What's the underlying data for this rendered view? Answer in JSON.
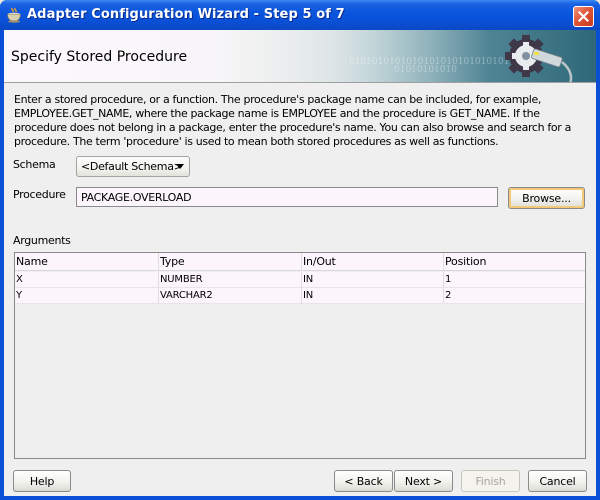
{
  "window": {
    "title": "Adapter Configuration Wizard - Step 5 of 7",
    "icon": "java-cup-icon",
    "close_icon": "close-icon"
  },
  "header": {
    "title": "Specify Stored Procedure",
    "binary_line1": "0101010101010101010101010101",
    "binary_line2": "01010101010"
  },
  "description": "Enter a stored procedure, or a function. The procedure's package name can be included, for example, EMPLOYEE.GET_NAME, where the package name is EMPLOYEE and the procedure is GET_NAME.  If the procedure does not belong in a package, enter the procedure's name. You can also browse and search for a procedure. The term 'procedure' is used to mean both stored procedures as well as functions.",
  "form": {
    "schema_label": "Schema",
    "schema_value": "<Default Schema>",
    "procedure_label": "Procedure",
    "procedure_value": "PACKAGE.OVERLOAD",
    "browse_button": "Browse...",
    "arguments_label": "Arguments"
  },
  "arguments_table": {
    "columns": [
      "Name",
      "Type",
      "In/Out",
      "Position"
    ],
    "rows": [
      {
        "name": "X",
        "type": "NUMBER",
        "inout": "IN",
        "position": "1"
      },
      {
        "name": "Y",
        "type": "VARCHAR2",
        "inout": "IN",
        "position": "2"
      }
    ]
  },
  "footer": {
    "help": "Help",
    "back": "< Back",
    "next": "Next >",
    "finish": "Finish",
    "cancel": "Cancel"
  },
  "colors": {
    "titlebar": "#0a50d6",
    "client_bg": "#efefef",
    "input_bg": "#fcf6fc",
    "focus_ring": "#f5c878",
    "close_button": "#e0553a"
  }
}
